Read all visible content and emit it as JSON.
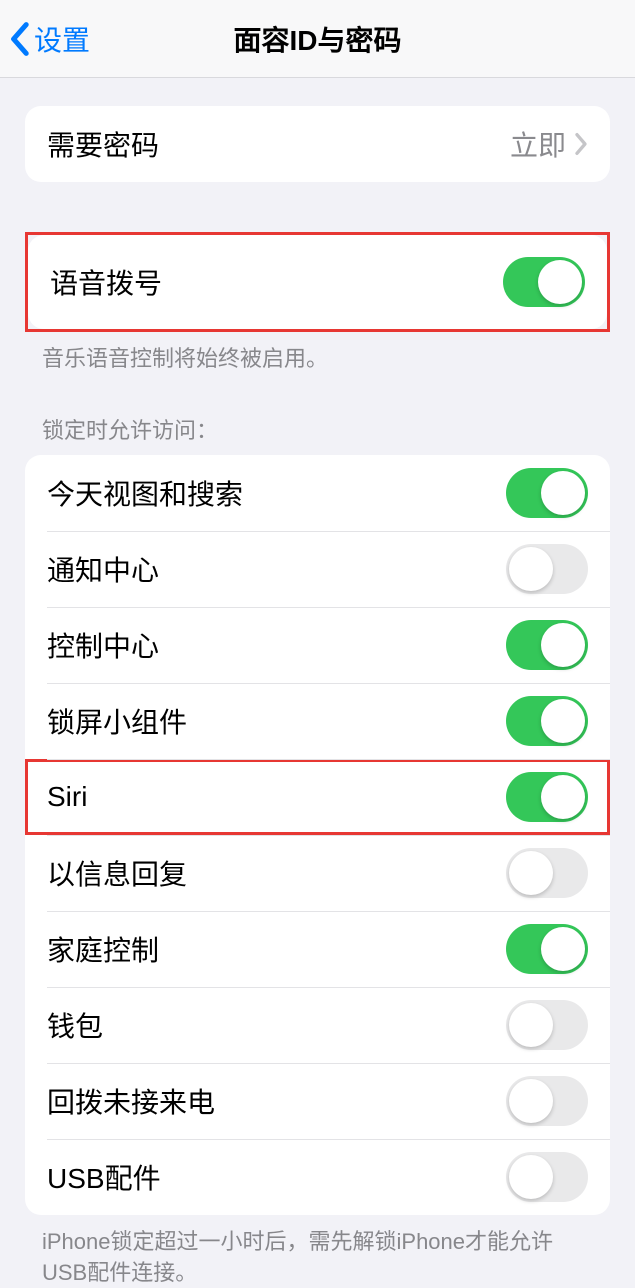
{
  "nav": {
    "back_label": "设置",
    "title": "面容ID与密码"
  },
  "passcode_row": {
    "label": "需要密码",
    "value": "立即"
  },
  "voice_dial": {
    "label": "语音拨号",
    "on": true,
    "footer": "音乐语音控制将始终被启用。"
  },
  "lock_access": {
    "header": "锁定时允许访问：",
    "items": [
      {
        "label": "今天视图和搜索",
        "on": true
      },
      {
        "label": "通知中心",
        "on": false
      },
      {
        "label": "控制中心",
        "on": true
      },
      {
        "label": "锁屏小组件",
        "on": true
      },
      {
        "label": "Siri",
        "on": true
      },
      {
        "label": "以信息回复",
        "on": false
      },
      {
        "label": "家庭控制",
        "on": true
      },
      {
        "label": "钱包",
        "on": false
      },
      {
        "label": "回拨未接来电",
        "on": false
      },
      {
        "label": "USB配件",
        "on": false
      }
    ],
    "footer": "iPhone锁定超过一小时后，需先解锁iPhone才能允许USB配件连接。"
  }
}
